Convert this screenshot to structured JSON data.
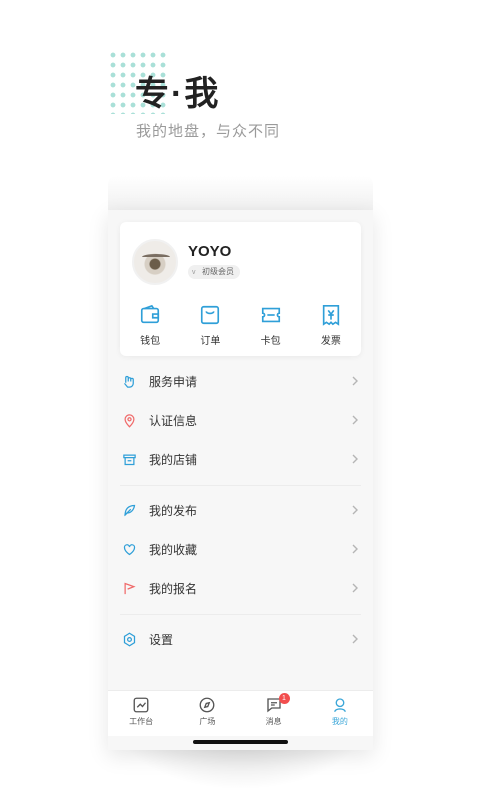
{
  "hero": {
    "title": "专·我",
    "subtitle": "我的地盘，与众不同"
  },
  "profile": {
    "name": "YOYO",
    "badge_prefix": "v",
    "badge": "初级会员"
  },
  "quick_actions": [
    {
      "label": "钱包",
      "icon": "wallet-icon"
    },
    {
      "label": "订单",
      "icon": "bag-icon"
    },
    {
      "label": "卡包",
      "icon": "ticket-icon"
    },
    {
      "label": "发票",
      "icon": "invoice-icon"
    }
  ],
  "menu": {
    "group1": [
      {
        "label": "服务申请",
        "icon": "hand-icon",
        "color": "#2f9fd8"
      },
      {
        "label": "认证信息",
        "icon": "location-pin-icon",
        "color": "#f06a6a"
      },
      {
        "label": "我的店铺",
        "icon": "store-icon",
        "color": "#2f9fd8"
      }
    ],
    "group2": [
      {
        "label": "我的发布",
        "icon": "feather-icon",
        "color": "#2f9fd8"
      },
      {
        "label": "我的收藏",
        "icon": "heart-icon",
        "color": "#2f9fd8"
      },
      {
        "label": "我的报名",
        "icon": "flag-icon",
        "color": "#f06a6a"
      }
    ],
    "group3": [
      {
        "label": "设置",
        "icon": "gear-icon",
        "color": "#2f9fd8"
      }
    ]
  },
  "tabbar": [
    {
      "label": "工作台",
      "icon": "chart-icon"
    },
    {
      "label": "广场",
      "icon": "compass-icon"
    },
    {
      "label": "消息",
      "icon": "message-icon",
      "badge": "1"
    },
    {
      "label": "我的",
      "icon": "user-icon",
      "active": true
    }
  ],
  "colors": {
    "accent": "#2f9fd8",
    "alert": "#f06a6a",
    "dots": "#a9e0d8"
  }
}
